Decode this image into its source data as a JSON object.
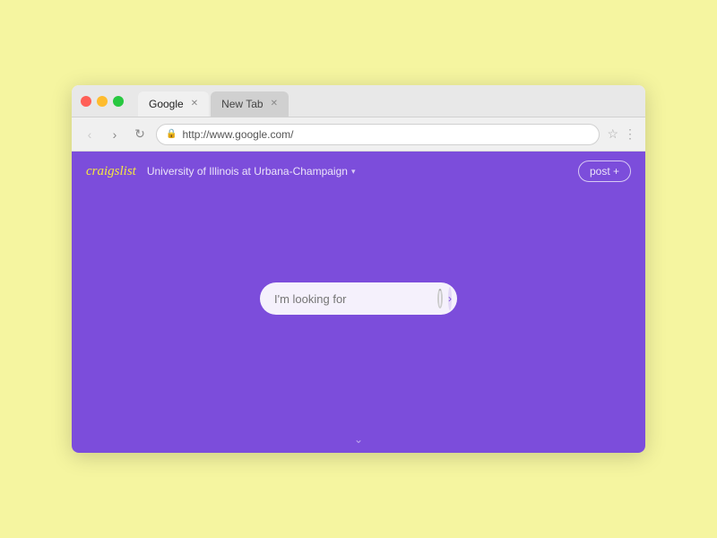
{
  "browser": {
    "tabs": [
      {
        "label": "Google",
        "active": true,
        "closeable": true
      },
      {
        "label": "New Tab",
        "active": false,
        "closeable": true
      }
    ],
    "url": "http://www.google.com/",
    "url_display": "http://www.google.com/"
  },
  "page": {
    "background_color": "#7c4ddb",
    "logo": "craigslist",
    "location": "University of Illinois at Urbana-Champaign",
    "location_arrow": "▾",
    "post_button": "post +",
    "search_placeholder": "I'm looking for",
    "chevron": "⌄"
  },
  "nav": {
    "back": "‹",
    "forward": "›",
    "reload": "↻"
  }
}
